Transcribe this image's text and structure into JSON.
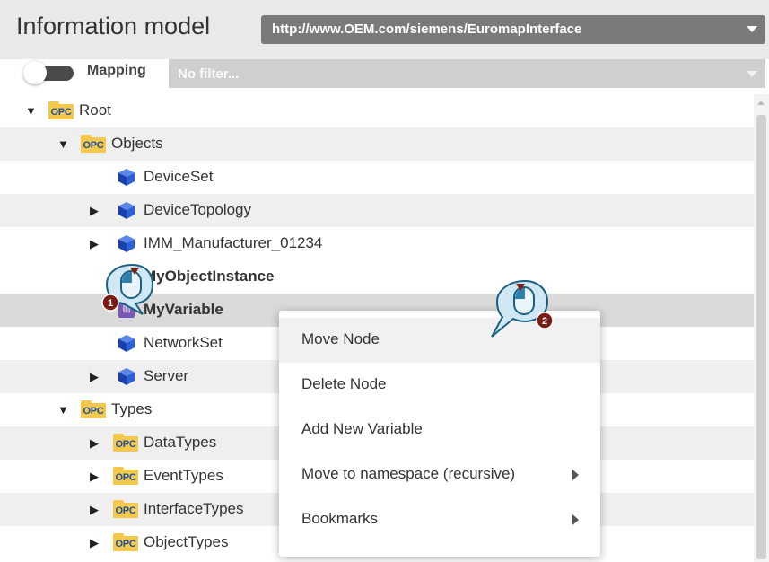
{
  "header": {
    "title": "Information model",
    "namespace_value": "http://www.OEM.com/siemens/EuromapInterface",
    "mapping_label": "Mapping",
    "mapping_enabled": false,
    "filter_placeholder": "No filter..."
  },
  "tree": [
    {
      "label": "Root",
      "icon": "opc-folder-icon",
      "expander": "expanded"
    },
    {
      "label": "Objects",
      "icon": "opc-folder-icon",
      "expander": "expanded"
    },
    {
      "label": "DeviceSet",
      "icon": "object-cube-icon",
      "expander": "none"
    },
    {
      "label": "DeviceTopology",
      "icon": "object-cube-icon",
      "expander": "collapsed"
    },
    {
      "label": "IMM_Manufacturer_01234",
      "icon": "object-cube-icon",
      "expander": "collapsed"
    },
    {
      "label": "MyObjectInstance",
      "icon": "object-cube-icon",
      "expander": "none"
    },
    {
      "label": "MyVariable",
      "icon": "variable-icon",
      "expander": "none",
      "selected": true
    },
    {
      "label": "NetworkSet",
      "icon": "object-cube-icon",
      "expander": "none"
    },
    {
      "label": "Server",
      "icon": "object-cube-icon",
      "expander": "collapsed"
    },
    {
      "label": "Types",
      "icon": "opc-folder-icon",
      "expander": "expanded"
    },
    {
      "label": "DataTypes",
      "icon": "opc-folder-icon",
      "expander": "collapsed"
    },
    {
      "label": "EventTypes",
      "icon": "opc-folder-icon",
      "expander": "collapsed"
    },
    {
      "label": "InterfaceTypes",
      "icon": "opc-folder-icon",
      "expander": "collapsed"
    },
    {
      "label": "ObjectTypes",
      "icon": "opc-folder-icon",
      "expander": "collapsed"
    }
  ],
  "opc_icon_text": "OPC",
  "context_menu": [
    {
      "label": "Move Node",
      "submenu": false,
      "hover": true
    },
    {
      "label": "Delete Node",
      "submenu": false
    },
    {
      "label": "Add New Variable",
      "submenu": false
    },
    {
      "label": "Move to namespace (recursive)",
      "submenu": true
    },
    {
      "label": "Bookmarks",
      "submenu": true
    }
  ],
  "callouts": [
    {
      "number": "1",
      "icon": "mouse-click-callout-icon"
    },
    {
      "number": "2",
      "icon": "mouse-click-callout-icon"
    }
  ],
  "colors": {
    "header_bg": "#e9e9e9",
    "select_bg": "#7a7a7a",
    "opc_folder": "#f4c84a",
    "cube": "#2255cc",
    "variable": "#7a56b5",
    "callout_badge": "#7b1c14",
    "callout_fill": "#cfe8f3",
    "callout_stroke": "#1b5f82"
  }
}
